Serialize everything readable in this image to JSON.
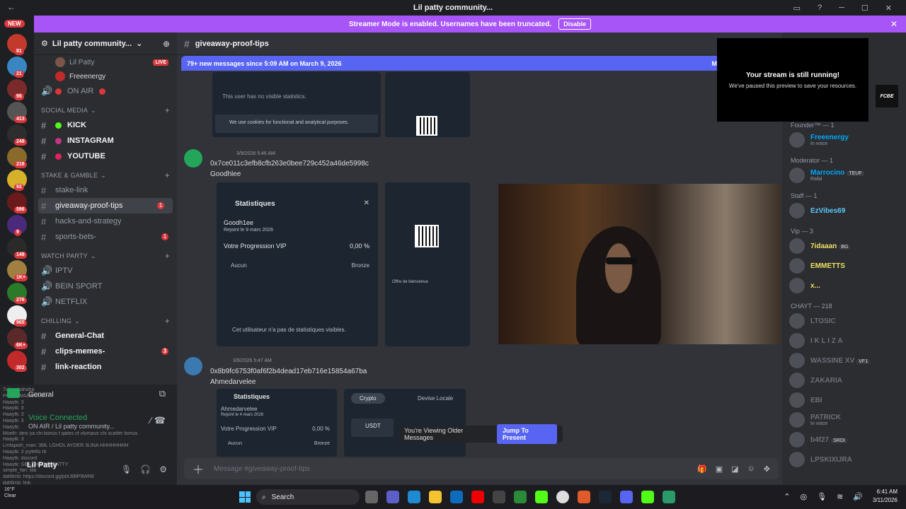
{
  "window": {
    "title": "Lil patty community...",
    "back_glyph": "←"
  },
  "banner": {
    "text": "Streamer Mode is enabled. Usernames have been truncated.",
    "disable": "Disable",
    "close": "✕"
  },
  "rail": {
    "new_label": "NEW",
    "servers": [
      {
        "badge": "81",
        "color": "#c23a2c"
      },
      {
        "badge": "21",
        "color": "#3a86c2"
      },
      {
        "badge": "96",
        "color": "#7a2a2a"
      },
      {
        "badge": "413",
        "color": "#555"
      },
      {
        "badge": "248",
        "color": "#2d2d2d"
      },
      {
        "badge": "216",
        "color": "#8a6a2a"
      },
      {
        "badge": "92",
        "color": "#d8b12a"
      },
      {
        "badge": "596",
        "color": "#6a1a1a"
      },
      {
        "badge": "9",
        "color": "#4a2a7a"
      },
      {
        "badge": "148",
        "color": "#2a2a2a"
      },
      {
        "badge": "1K+",
        "color": "#a08040"
      },
      {
        "badge": "276",
        "color": "#2a7a2a"
      },
      {
        "badge": "965",
        "color": "#eee"
      },
      {
        "badge": "6K+",
        "color": "#5a2a2a"
      },
      {
        "badge": "302",
        "color": "#c02a2a"
      }
    ]
  },
  "guild": {
    "name": "Lil patty community...",
    "chevron": "⌄"
  },
  "sidebar": {
    "voice_users": [
      {
        "name": "Lil Patty",
        "live": "LIVE"
      },
      {
        "name": "Freeenergy"
      }
    ],
    "on_air": "ON AIR",
    "categories": [
      {
        "name": "SOCIAL MEDIA",
        "channels": [
          {
            "label": "KICK",
            "bold": true
          },
          {
            "label": "INSTAGRAM",
            "bold": true
          },
          {
            "label": "YOUTUBE",
            "bold": true
          }
        ]
      },
      {
        "name": "STAKE & GAMBLE",
        "channels": [
          {
            "label": "stake-link"
          },
          {
            "label": "giveaway-proof-tips",
            "selected": true,
            "badge": "1"
          },
          {
            "label": "hacks-and-strategy"
          },
          {
            "label": "sports-bets-",
            "badge": "1"
          }
        ]
      },
      {
        "name": "WATCH PARTY",
        "channels": [
          {
            "label": "IPTV",
            "voice": true
          },
          {
            "label": "BEIN SPORT",
            "voice": true
          },
          {
            "label": "NETFLIX",
            "voice": true
          }
        ]
      },
      {
        "name": "CHILLING",
        "channels": [
          {
            "label": "General-Chat",
            "bold": true
          },
          {
            "label": "clips-memes-",
            "bold": true,
            "badge": "3"
          },
          {
            "label": "link-reaction",
            "bold": true
          }
        ]
      }
    ]
  },
  "voice_panel": {
    "channel": "General",
    "status": "Voice Connected",
    "sub": "ON AIR / Lil patty community...",
    "user": "Lil Patty",
    "chat_lines": [
      "7alaq: hahaha",
      "Prefix: WAAAAAAAH",
      "Haaytk: 3",
      "Haaytk: 3",
      "Haaytk: 3",
      "Haaytk: 3",
      "Haaytk:",
      "Moelh: desi ya chi bonus f gates of olympus chi scatter bonus",
      "Haaytk: 3",
      "Lmfajaoh_man: 3ML LGHOL AYDER 3LINA HHHHHHHH",
      "Haaytk: 3 yiyfeflo rb",
      "Haaytk: discord",
      "Haaytk: SBA7 HADA APATTY",
      "simple_fan: ida",
      "dafi6mb: https://discord.gg/pbU88P9WR8",
      "dafi6mb: link"
    ]
  },
  "channel_header": {
    "name": "giveaway-proof-tips"
  },
  "new_messages": {
    "text": "79+ new messages since 5:09 AM on March 9, 2026",
    "mark": "Ma"
  },
  "messages": [
    {
      "time": "3/9/2026 5:46 AM",
      "text1": "0x7ce011c3efb8cfb263e0bee729c452a46de5998c",
      "text2": "Goodhlee",
      "card_title": "Statistiques",
      "card_user": "Goodh1ee",
      "card_joined": "Rejoint le 9 mars 2026",
      "card_vip": "Votre Progression VIP",
      "card_vip_val": "0,00 %",
      "card_none": "Aucun",
      "card_bronze": "Bronze",
      "card_empty": "Cet utilisateur n'a pas de statistiques visibles.",
      "offer_title": "Offre de bienvenue"
    },
    {
      "time": "3/9/2026 5:47 AM",
      "text1": "0x8b9fc6753f0af6f2b4dead17eb716e15854a67ba",
      "text2": "Ahmedarvelee",
      "card_title": "Statistiques",
      "card_user": "Ahmedarvelee",
      "card_joined": "Rejoint le 4 mars 2026",
      "card_vip": "Votre Progression VIP",
      "card_vip_val": "0,00 %",
      "card_none": "Aucun",
      "card_bronze": "Bronze",
      "tab_crypto": "Crypto",
      "tab_local": "Devise Locale",
      "coin": "USDT"
    }
  ],
  "prev_card": {
    "line1": "This user has no visible statistics.",
    "line2": "We use cookies for functional and analytical purposes."
  },
  "older": {
    "text": "You're Viewing Older Messages",
    "jump": "Jump To Present"
  },
  "composer": {
    "placeholder": "Message #giveaway-proof-tips"
  },
  "popup": {
    "title": "Your stream is still running!",
    "sub": "We've paused this preview to save your resources.",
    "logo": "FCBE"
  },
  "members": {
    "groups": [
      {
        "label": "Founder™ — 1",
        "items": [
          {
            "name": "Freeenergy",
            "sub": "In voice",
            "color": "#00a8fc"
          }
        ]
      },
      {
        "label": "Moderator — 1",
        "items": [
          {
            "name": "Marrocino",
            "tag": "TEUF",
            "sub": "Rafal",
            "color": "#00a8fc"
          }
        ]
      },
      {
        "label": "Staff — 1",
        "items": [
          {
            "name": "EzVibes69",
            "color": "#5ac8fa"
          }
        ]
      },
      {
        "label": "Vip — 3",
        "items": [
          {
            "name": "7idaaan",
            "tag": "BG",
            "color": "#f0e060"
          },
          {
            "name": "EMMETTS",
            "color": "#f0e060"
          },
          {
            "name": "x...",
            "color": "#f0e060"
          }
        ]
      },
      {
        "label": "CHAYT — 218",
        "items": [
          {
            "name": "LTOSIC",
            "color": "#6d6f78"
          },
          {
            "name": "I K L I Z A",
            "color": "#6d6f78"
          },
          {
            "name": "WASSINE XV",
            "tag": "VF1",
            "color": "#6d6f78"
          },
          {
            "name": "ZAKARIA",
            "color": "#6d6f78"
          },
          {
            "name": "EBI",
            "color": "#6d6f78"
          },
          {
            "name": "PATRICK",
            "sub": "In voice",
            "color": "#6d6f78"
          },
          {
            "name": "b4f27",
            "tag": "SRDI",
            "color": "#6d6f78"
          },
          {
            "name": "LPSKIXIJRA",
            "color": "#6d6f78"
          }
        ]
      }
    ]
  },
  "taskbar": {
    "search": "Search",
    "weather_temp": "16°F",
    "weather_desc": "Clear",
    "time": "6:41 AM",
    "date": "3/11/2026"
  }
}
